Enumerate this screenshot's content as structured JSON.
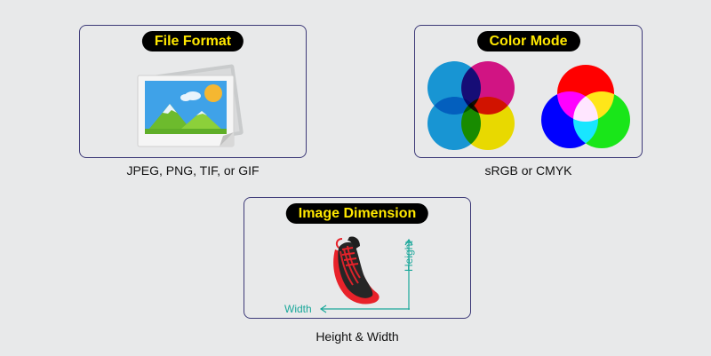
{
  "cards": {
    "file_format": {
      "title": "File Format",
      "caption": "JPEG, PNG, TIF, or GIF",
      "icon": "image-file-icon"
    },
    "color_mode": {
      "title": "Color Mode",
      "caption": "sRGB or CMYK",
      "icons": [
        "cmyk-circles-icon",
        "rgb-circles-icon"
      ]
    },
    "image_dimension": {
      "title": "Image Dimension",
      "caption": "Height & Width",
      "height_label": "Height",
      "width_label": "Width",
      "icon": "sneaker-image"
    }
  },
  "colors": {
    "background": "#e8e9ea",
    "card_border": "#3d3a78",
    "pill_bg": "#000000",
    "pill_text": "#ffe800",
    "dimension_arrow": "#1aa79a",
    "cyan": "#1aa3e6",
    "magenta": "#e6158f",
    "yellow": "#ffee00",
    "red": "#ff0000",
    "green": "#19e619",
    "blue": "#0000ff"
  }
}
